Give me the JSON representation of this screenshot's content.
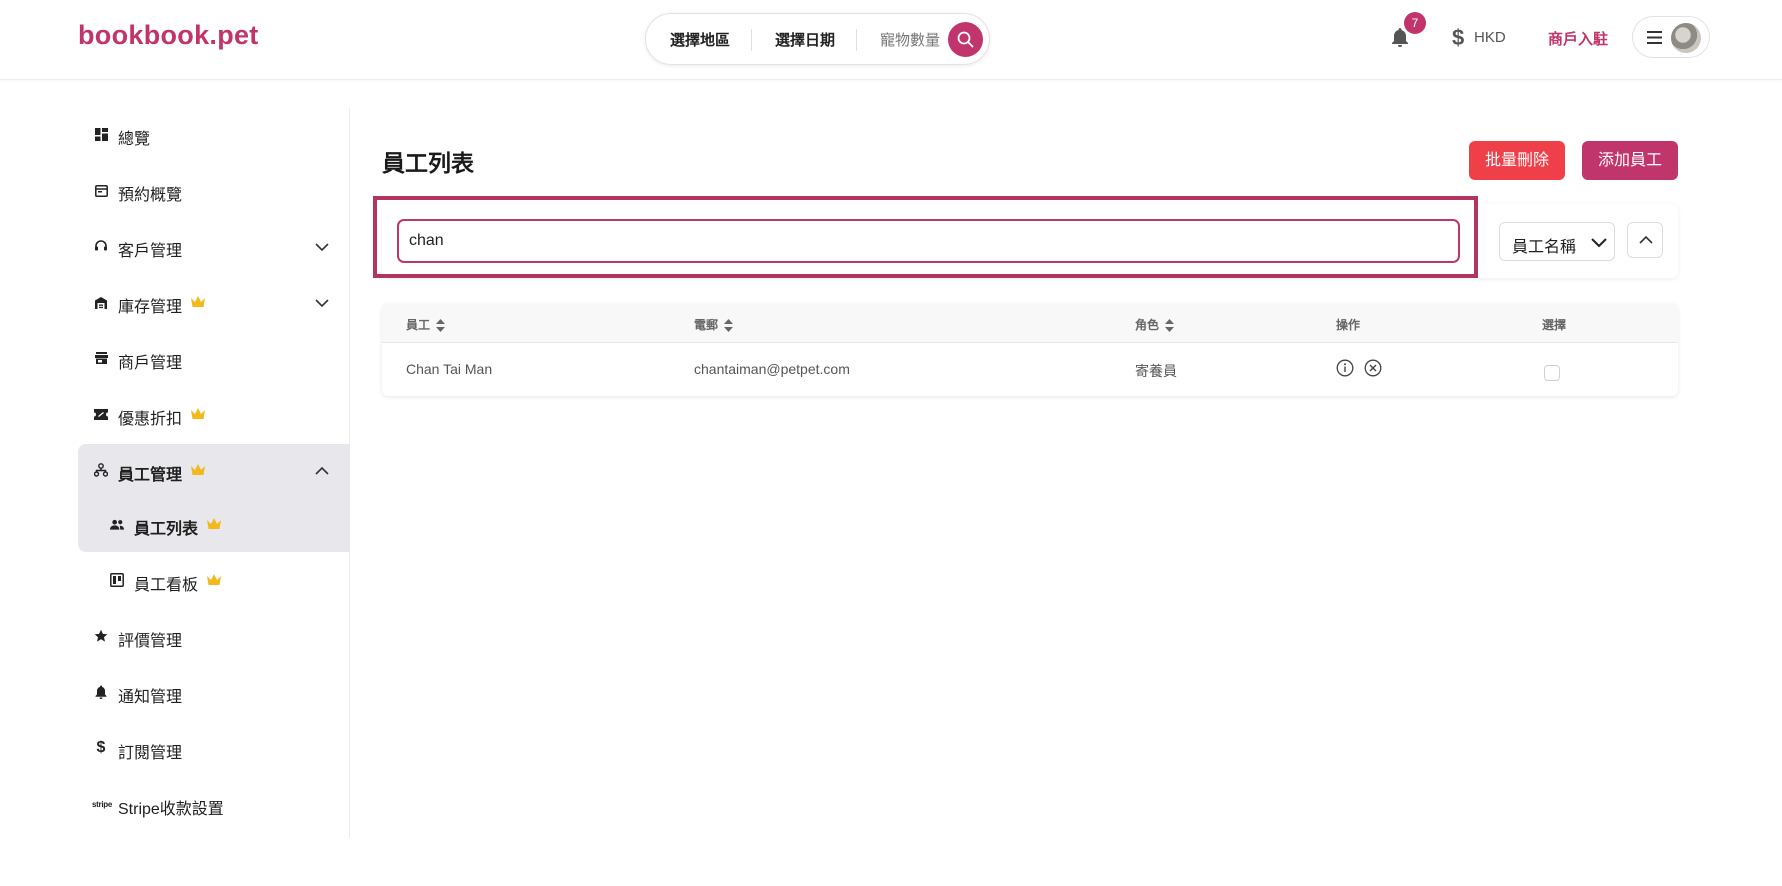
{
  "header": {
    "logo": "bookbook.pet",
    "search": {
      "region": "選擇地區",
      "date": "選擇日期",
      "pets": "寵物數量"
    },
    "notification_count": "7",
    "currency": "HKD",
    "merchant_link": "商戶入駐"
  },
  "sidebar": {
    "items": [
      {
        "label": "總覽"
      },
      {
        "label": "預約概覽"
      },
      {
        "label": "客戶管理"
      },
      {
        "label": "庫存管理"
      },
      {
        "label": "商戶管理"
      },
      {
        "label": "優惠折扣"
      },
      {
        "label": "員工管理"
      },
      {
        "label": "員工列表"
      },
      {
        "label": "員工看板"
      },
      {
        "label": "評價管理"
      },
      {
        "label": "通知管理"
      },
      {
        "label": "訂閱管理"
      },
      {
        "label": "Stripe收款設置"
      }
    ]
  },
  "main": {
    "title": "員工列表",
    "bulk_delete_label": "批量刪除",
    "add_staff_label": "添加員工",
    "search_value": "chan",
    "sort_by": "員工名稱",
    "table": {
      "headers": [
        "員工",
        "電郵",
        "角色",
        "操作",
        "選擇"
      ],
      "rows": [
        {
          "name": "Chan Tai Man",
          "email": "chantaiman@petpet.com",
          "role": "寄養員"
        }
      ]
    }
  },
  "colors": {
    "brand": "#c0356b",
    "danger": "#ef3f49",
    "crown": "#f2b81c"
  }
}
